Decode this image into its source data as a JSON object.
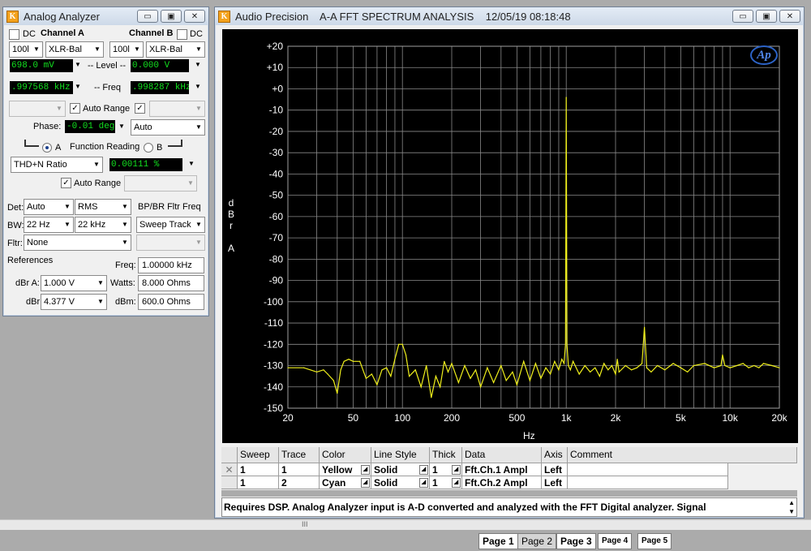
{
  "analyzer_window": {
    "title": "Analog Analyzer",
    "dc_a_label": "DC",
    "channel_a_label": "Channel A",
    "channel_b_label": "Channel B",
    "dc_b_label": "DC",
    "range_a": "100l",
    "input_a": "XLR-Bal",
    "range_b": "100l",
    "input_b": "XLR-Bal",
    "level_a_value": "698.0   mV",
    "level_label": "-- Level --",
    "level_b_value": "0.000   V",
    "freq_a_value": ".997568 kHz",
    "freq_label": "-- Freq",
    "freq_b_value": ".998287 kHz",
    "auto_range_label": "Auto Range",
    "phase_label": "Phase:",
    "phase_value": "-0.01   deg",
    "phase_mode": "Auto",
    "function_reading_label": "Function Reading",
    "radio_a_label": "A",
    "radio_b_label": "B",
    "function_select": "THD+N Ratio",
    "function_value": "0.00111  %",
    "auto_range_label2": "Auto Range",
    "det_label": "Det:",
    "det_value": "Auto",
    "det_mode": "RMS",
    "bpbr_label": "BP/BR Fltr Freq",
    "bw_label": "BW:",
    "bw_low": "22 Hz",
    "bw_high": "22 kHz",
    "sweep_track": "Sweep Track",
    "fltr_label": "Fltr:",
    "fltr_value": "None",
    "references_label": "References",
    "freq_ref_label": "Freq:",
    "freq_ref_value": "1.00000 kHz",
    "dbra_label": "dBr A:",
    "dbra_value": "1.000    V",
    "watts_label": "Watts:",
    "watts_value": "8.000    Ohms",
    "dbrb_label": "dBr",
    "dbrb_value": "4.377    V",
    "dbm_label": "dBm:",
    "dbm_value": "600.0    Ohms"
  },
  "graph_window": {
    "title": "Audio Precision    A-A FFT SPECTRUM ANALYSIS    12/05/19 08:18:48",
    "logo": "Ap",
    "y_axis_label_lines": [
      "d",
      "B",
      "r",
      "",
      "A"
    ],
    "x_axis_label": "Hz"
  },
  "chart_data": {
    "type": "line",
    "xscale": "log",
    "xlim": [
      20,
      20000
    ],
    "ylim": [
      -150,
      20
    ],
    "ylabel": "dBr A",
    "xlabel": "Hz",
    "x_ticks": [
      20,
      50,
      100,
      200,
      500,
      1000,
      2000,
      5000,
      10000,
      20000
    ],
    "x_tick_labels": [
      "20",
      "50",
      "100",
      "200",
      "500",
      "1k",
      "2k",
      "5k",
      "10k",
      "20k"
    ],
    "y_ticks": [
      20,
      10,
      0,
      -10,
      -20,
      -30,
      -40,
      -50,
      -60,
      -70,
      -80,
      -90,
      -100,
      -110,
      -120,
      -130,
      -140,
      -150
    ],
    "y_tick_labels": [
      "+20",
      "+10",
      "+0",
      "-10",
      "-20",
      "-30",
      "-40",
      "-50",
      "-60",
      "-70",
      "-80",
      "-90",
      "-100",
      "-110",
      "-120",
      "-130",
      "-140",
      "-150"
    ],
    "grid": true,
    "series": [
      {
        "color": "#f0f01c",
        "x": [
          20,
          25,
          30,
          33,
          35,
          38,
          40,
          42,
          44,
          47,
          50,
          55,
          60,
          65,
          70,
          75,
          80,
          85,
          90,
          95,
          100,
          105,
          110,
          120,
          130,
          140,
          150,
          160,
          170,
          180,
          190,
          200,
          220,
          240,
          260,
          280,
          300,
          330,
          360,
          400,
          430,
          470,
          500,
          550,
          600,
          650,
          700,
          750,
          800,
          850,
          900,
          940,
          970,
          990,
          1000,
          1010,
          1030,
          1060,
          1100,
          1200,
          1300,
          1400,
          1500,
          1600,
          1700,
          1800,
          1900,
          2000,
          2050,
          2100,
          2300,
          2500,
          2700,
          2900,
          3000,
          3100,
          3300,
          3600,
          4000,
          4500,
          5000,
          5500,
          6000,
          7000,
          8000,
          8800,
          9000,
          9300,
          10000,
          11000,
          12000,
          13000,
          14000,
          15000,
          16000,
          18000,
          20000
        ],
        "y": [
          -131,
          -131,
          -133,
          -132,
          -134,
          -137,
          -143,
          -132,
          -128,
          -127,
          -128,
          -128,
          -136,
          -134,
          -139,
          -132,
          -131,
          -135,
          -127,
          -120,
          -120,
          -125,
          -135,
          -132,
          -140,
          -130,
          -145,
          -135,
          -140,
          -128,
          -133,
          -129,
          -138,
          -130,
          -136,
          -132,
          -140,
          -131,
          -138,
          -130,
          -137,
          -133,
          -139,
          -128,
          -137,
          -129,
          -136,
          -131,
          -134,
          -128,
          -132,
          -127,
          -129,
          -120,
          -4,
          -120,
          -130,
          -132,
          -128,
          -134,
          -130,
          -133,
          -131,
          -135,
          -129,
          -132,
          -130,
          -134,
          -127,
          -133,
          -130,
          -132,
          -131,
          -129,
          -112,
          -131,
          -133,
          -130,
          -132,
          -129,
          -131,
          -133,
          -130,
          -129,
          -131,
          -130,
          -125,
          -130,
          -131,
          -130,
          -129,
          -131,
          -130,
          -131,
          -129,
          -130,
          -131
        ]
      }
    ]
  },
  "grid_table": {
    "headers": [
      "Sweep",
      "Trace",
      "Color",
      "Line Style",
      "Thick",
      "Data",
      "Axis",
      "Comment"
    ],
    "rows": [
      {
        "check": "✕",
        "sweep": "1",
        "trace": "1",
        "color": "Yellow",
        "style": "Solid",
        "thick": "1",
        "data": "Fft.Ch.1 Ampl",
        "axis": "Left",
        "comment": ""
      },
      {
        "check": "",
        "sweep": "1",
        "trace": "2",
        "color": "Cyan",
        "style": "Solid",
        "thick": "1",
        "data": "Fft.Ch.2 Ampl",
        "axis": "Left",
        "comment": ""
      }
    ]
  },
  "comment_text": "Requires DSP.  Analog Analyzer input is A-D converted and analyzed with the FFT Digital analyzer.  Signal",
  "hscroll_grip": "III",
  "pages": [
    "Page 1",
    "Page 2",
    "Page 3",
    "Page 4",
    "Page 5"
  ],
  "icons": {
    "app_icon": "ap-logo-icon",
    "minimize": "minimize-icon",
    "maximize": "maximize-icon",
    "close": "close-icon"
  }
}
